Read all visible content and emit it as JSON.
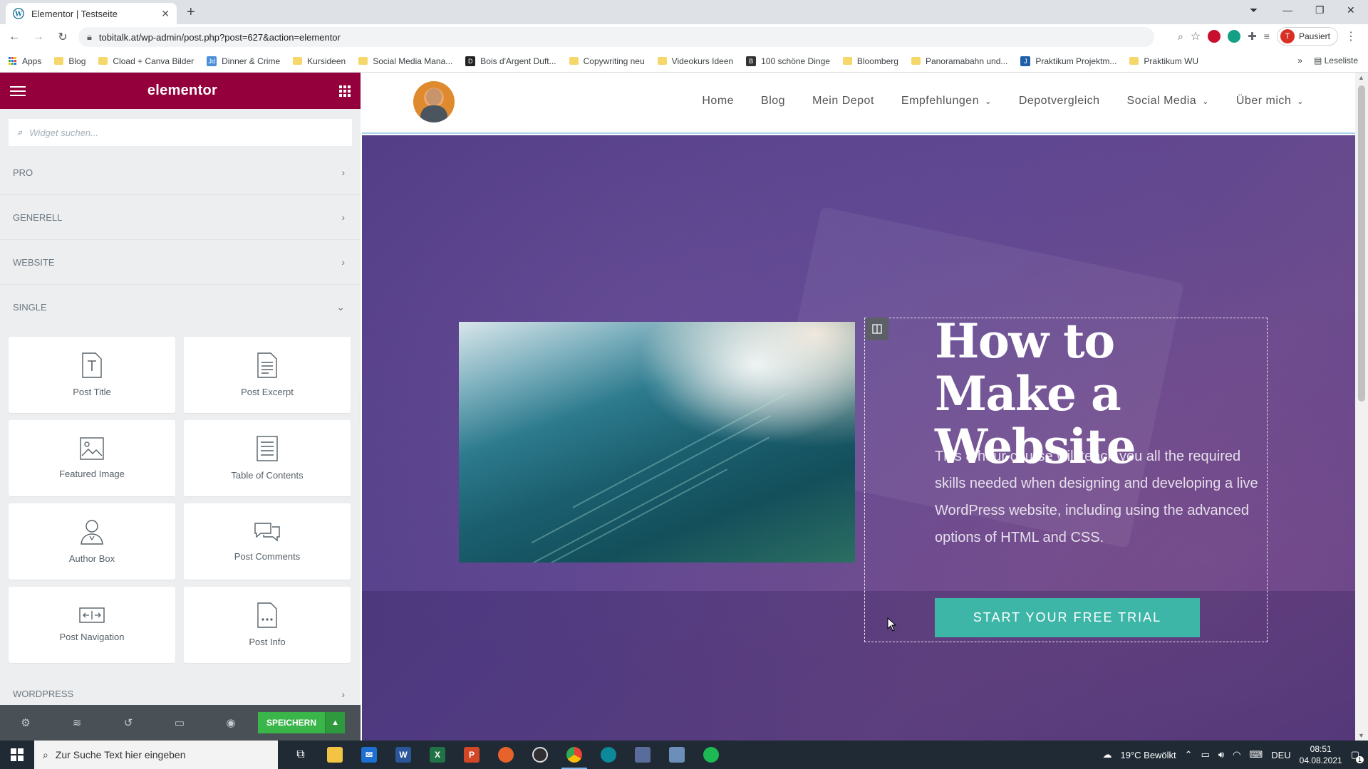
{
  "browser": {
    "tab_title": "Elementor | Testseite",
    "tab_close": "✕",
    "new_tab": "+",
    "url": "tobitalk.at/wp-admin/post.php?post=627&action=elementor",
    "profile_initial": "T",
    "profile_status": "Pausiert",
    "reading_list": "Leseliste"
  },
  "bookmarks": [
    {
      "label": "Apps",
      "type": "apps"
    },
    {
      "label": "Blog",
      "type": "folder"
    },
    {
      "label": "Cload + Canva Bilder",
      "type": "folder"
    },
    {
      "label": "Dinner & Crime",
      "type": "site",
      "color": "#4a90d9",
      "glyph": "Jd"
    },
    {
      "label": "Kursideen",
      "type": "folder"
    },
    {
      "label": "Social Media Mana...",
      "type": "folder"
    },
    {
      "label": "Bois d'Argent Duft...",
      "type": "site",
      "color": "#222222",
      "glyph": "D"
    },
    {
      "label": "Copywriting neu",
      "type": "folder"
    },
    {
      "label": "Videokurs Ideen",
      "type": "folder"
    },
    {
      "label": "100 schöne Dinge",
      "type": "site",
      "color": "#333333",
      "glyph": "B"
    },
    {
      "label": "Bloomberg",
      "type": "folder"
    },
    {
      "label": "Panoramabahn und...",
      "type": "folder"
    },
    {
      "label": "Praktikum Projektm...",
      "type": "site",
      "color": "#1f5fa8",
      "glyph": "J"
    },
    {
      "label": "Praktikum WU",
      "type": "folder"
    }
  ],
  "panel": {
    "brand": "elementor",
    "search_placeholder": "Widget suchen...",
    "categories_top": [
      {
        "label": "PRO",
        "chevron": "›"
      },
      {
        "label": "GENERELL",
        "chevron": "›"
      },
      {
        "label": "WEBSITE",
        "chevron": "›"
      },
      {
        "label": "SINGLE",
        "chevron": "⌄"
      }
    ],
    "widgets": [
      {
        "label": "Post Title",
        "icon": "post-title-icon"
      },
      {
        "label": "Post Excerpt",
        "icon": "post-excerpt-icon"
      },
      {
        "label": "Featured Image",
        "icon": "featured-image-icon"
      },
      {
        "label": "Table of Contents",
        "icon": "table-of-contents-icon"
      },
      {
        "label": "Author Box",
        "icon": "author-box-icon"
      },
      {
        "label": "Post Comments",
        "icon": "post-comments-icon"
      },
      {
        "label": "Post Navigation",
        "icon": "post-navigation-icon"
      },
      {
        "label": "Post Info",
        "icon": "post-info-icon"
      }
    ],
    "category_bottom": {
      "label": "WORDPRESS",
      "chevron": "›"
    },
    "save_label": "SPEICHERN"
  },
  "site": {
    "nav": [
      {
        "label": "Home",
        "dropdown": false
      },
      {
        "label": "Blog",
        "dropdown": false
      },
      {
        "label": "Mein Depot",
        "dropdown": false
      },
      {
        "label": "Empfehlungen",
        "dropdown": true
      },
      {
        "label": "Depotvergleich",
        "dropdown": false
      },
      {
        "label": "Social Media",
        "dropdown": true
      },
      {
        "label": "Über mich",
        "dropdown": true
      }
    ],
    "hero_title": "How to Make a Website",
    "hero_text": "This 8 hour course will teach you all the required skills needed when designing and developing a live WordPress website, including using the advanced options of HTML and CSS.",
    "cta_label": "START YOUR FREE TRIAL"
  },
  "taskbar": {
    "search_placeholder": "Zur Suche Text hier eingeben",
    "weather": "19°C  Bewölkt",
    "language": "DEU",
    "time": "08:51",
    "date": "04.08.2021",
    "notification_count": "1"
  },
  "colors": {
    "elementor_brand": "#93003c",
    "save_green": "#39b54a",
    "cta_teal": "#3db6a8",
    "hero_purple": "#5d4590"
  }
}
